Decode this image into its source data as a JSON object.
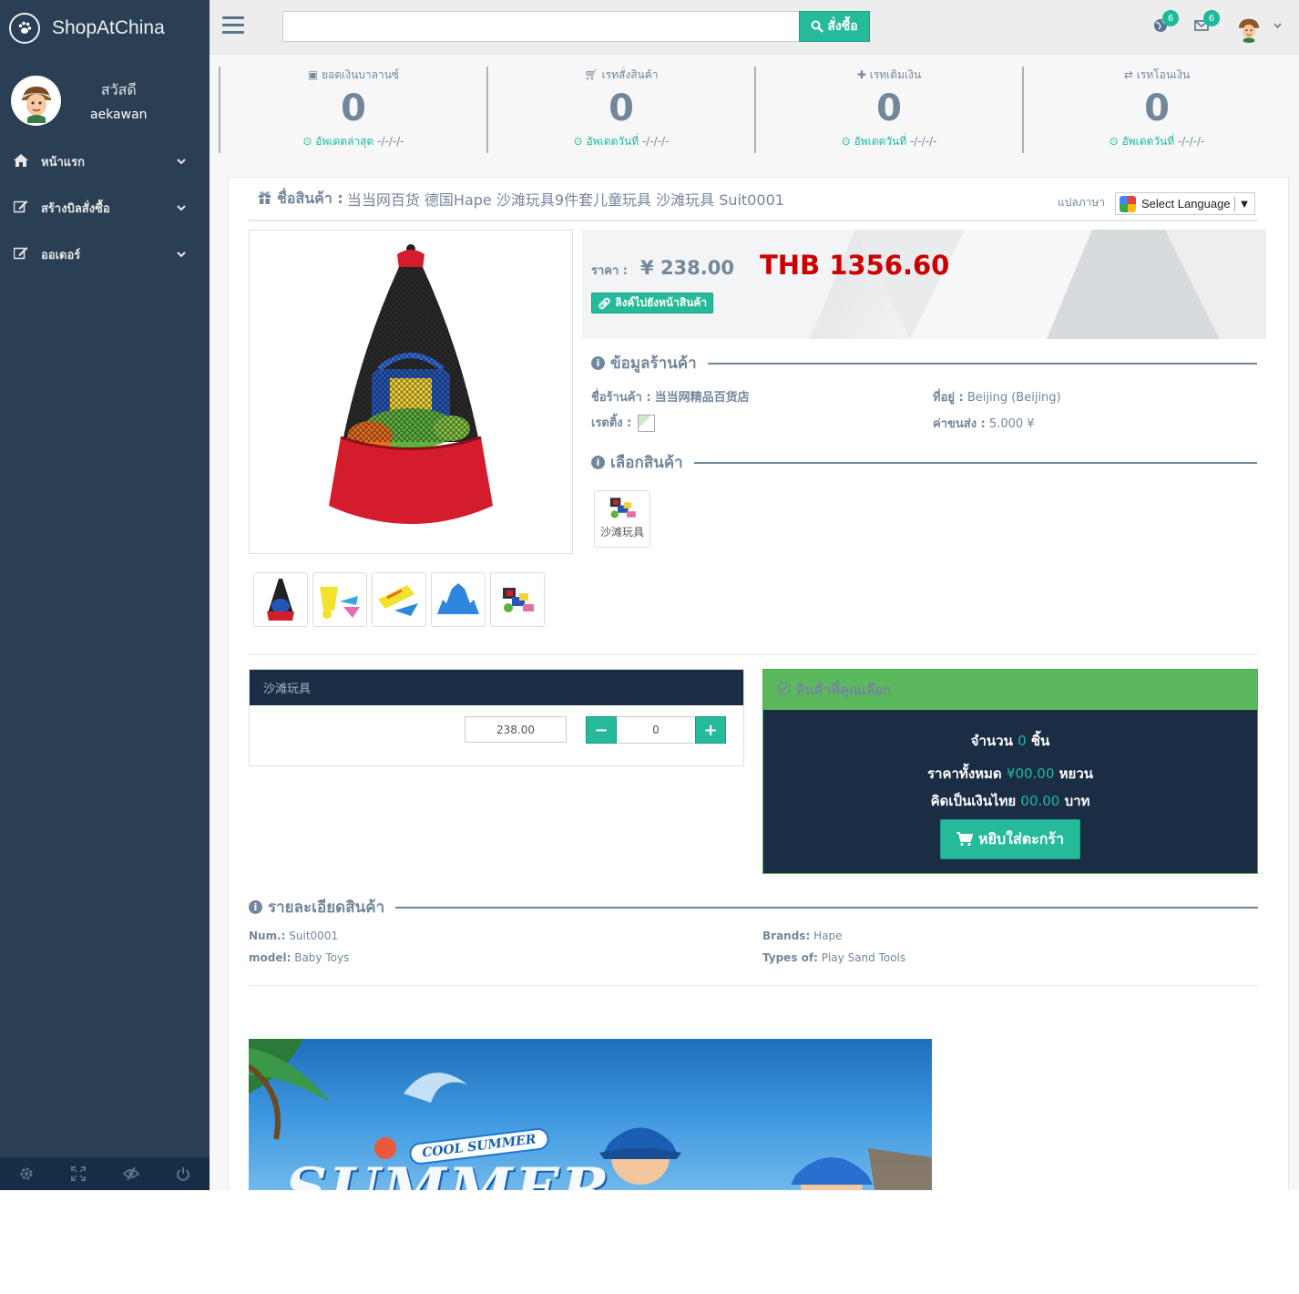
{
  "app": {
    "brand": "ShopAtChina"
  },
  "sidebar": {
    "greeting": "สวัสดี",
    "username": "aekawan",
    "items": [
      {
        "label": "หน้าแรก",
        "icon": "home-icon"
      },
      {
        "label": "สร้างบิลสั่งซื้อ",
        "icon": "edit-icon"
      },
      {
        "label": "ออเดอร์",
        "icon": "edit-icon"
      }
    ],
    "footer": [
      "gear-icon",
      "fullscreen-icon",
      "eye-slash-icon",
      "power-icon"
    ]
  },
  "topnav": {
    "search_value": "",
    "search_button": "สั่งซื้อ",
    "notify_count": "6",
    "mail_count": "6"
  },
  "tiles": [
    {
      "label": "ยอดเงินบาลานซ์",
      "icon": "money-icon",
      "count": "0",
      "sub_label": "อัพเดตล่าสุด",
      "sub_date": "-/-/-/-"
    },
    {
      "label": "เรทสั่งสินค้า",
      "icon": "cart-icon",
      "count": "0",
      "sub_label": "อัพเดตวันที่",
      "sub_date": "-/-/-/-"
    },
    {
      "label": "เรทเติมเงิน",
      "icon": "plus-icon",
      "count": "0",
      "sub_label": "อัพเดตวันที่",
      "sub_date": "-/-/-/-"
    },
    {
      "label": "เรทโอนเงิน",
      "icon": "exchange-icon",
      "count": "0",
      "sub_label": "อัพเดตวันที่",
      "sub_date": "-/-/-/-"
    }
  ],
  "product": {
    "title_label": "ชื่อสินค้า :",
    "title": "当当网百货 德国Hape 沙滩玩具9件套儿童玩具 沙滩玩具 Suit0001",
    "translate_label": "แปลภาษา",
    "language_select": "Select Language",
    "price_label": "ราคา :",
    "price_yuan": "¥ 238.00",
    "price_thb": "THB 1356.60",
    "link_button": "ลิงค์ไปยังหน้าสินค้า",
    "shop_section": "ข้อมูลร้านค้า",
    "shop_name_label": "ชื่อร้านค้า :",
    "shop_name": "当当网精品百货店",
    "rating_label": "เรตติ้ง :",
    "address_label": "ที่อยู่ :",
    "address": "Beijing (Beijing)",
    "shipping_label": "ค่าขนส่ง :",
    "shipping": "5.000 ¥",
    "choose_section": "เลือกสินค้า",
    "option_label": "沙滩玩具"
  },
  "order": {
    "option_header": "沙滩玩具",
    "unit_price": "238.00",
    "quantity": "0",
    "minus": "−",
    "plus": "+"
  },
  "summary": {
    "header": "สินค้าที่คุณเลือก",
    "qty_prefix": "จำนวน",
    "qty_value": "0",
    "qty_suffix": "ชิ้น",
    "total_prefix": "ราคาทั้งหมด",
    "total_value": "¥00.00",
    "total_suffix": "หยวน",
    "thb_prefix": "คิดเป็นเงินไทย",
    "thb_value": "00.00",
    "thb_suffix": "บาท",
    "cart_button": "หยิบใส่ตะกร้า"
  },
  "details": {
    "section": "รายละเอียดสินค้า",
    "num_label": "Num.:",
    "num_value": "Suit0001",
    "model_label": "model:",
    "model_value": "Baby Toys",
    "brands_label": "Brands:",
    "brands_value": "Hape",
    "types_label": "Types of:",
    "types_value": "Play Sand Tools"
  },
  "banner": {
    "tagline": "COOL SUMMER",
    "headline": "SUMMER"
  },
  "colors": {
    "sidebar": "#2a3f54",
    "accent": "#26b99a",
    "price_red": "#cc0000",
    "summary_bg": "#1b2d44",
    "summary_head": "#5cb85c"
  }
}
